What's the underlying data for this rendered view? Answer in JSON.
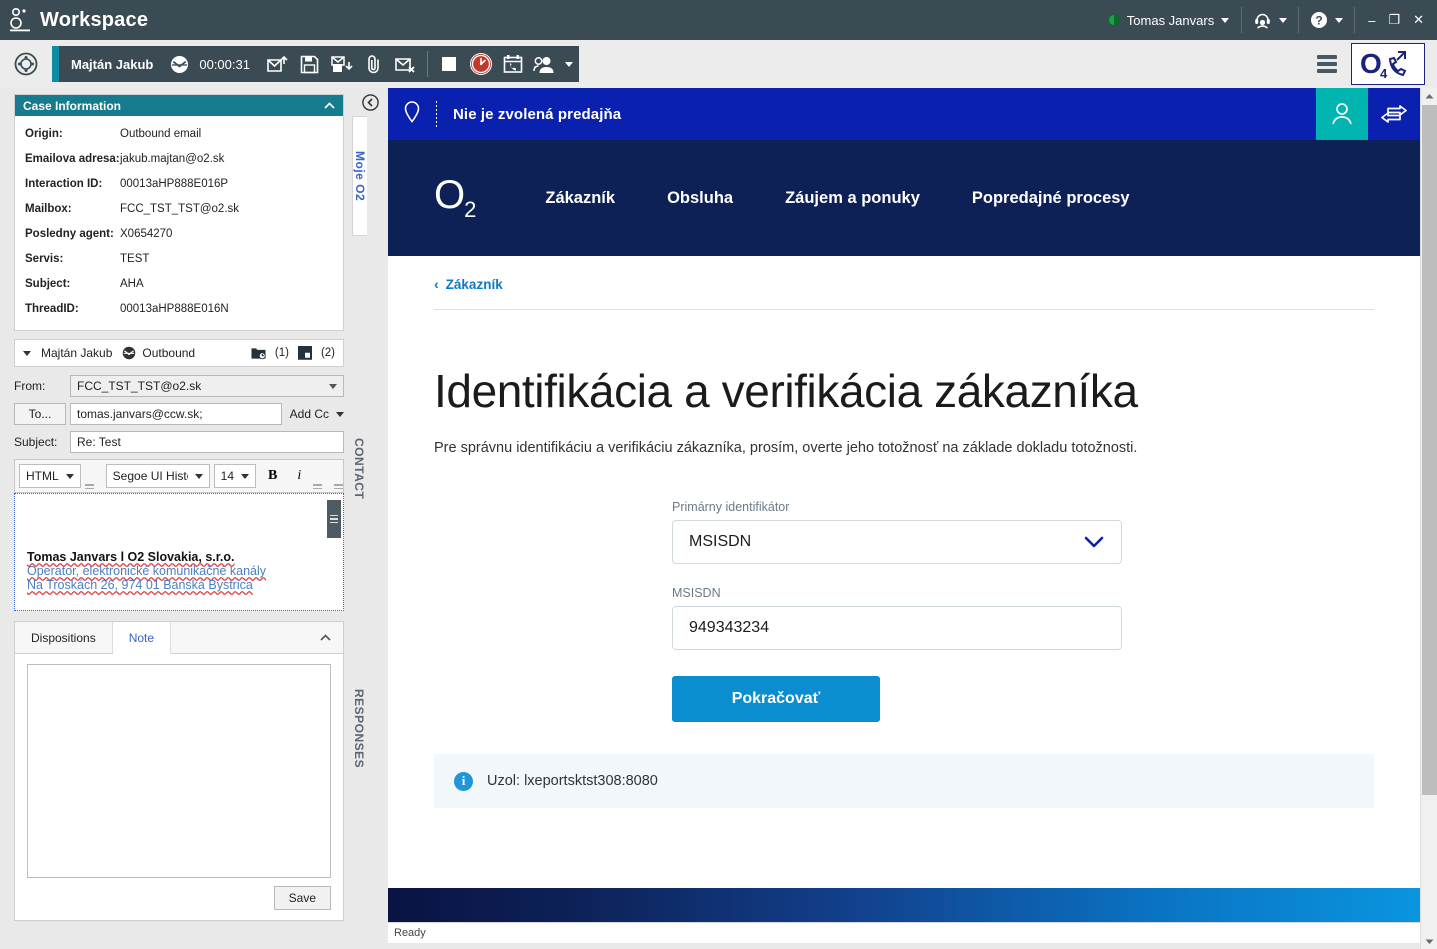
{
  "titlebar": {
    "app_name": "Workspace",
    "logo_icon": "genesys-logo-icon",
    "user_name": "Tomas Janvars",
    "status_icon": "status-half-available-icon",
    "agent_icon": "agent-headset-icon",
    "help_icon": "help-question-icon",
    "minimize": "–",
    "maximize": "❐",
    "close": "✕"
  },
  "toolbar": {
    "target_icon": "target-crosshair-icon",
    "interaction_name": "Majtán Jakub",
    "interaction_channel_icon": "email-channel-icon",
    "timer": "00:00:31",
    "icons": [
      "send-email-icon",
      "save-draft-icon",
      "move-to-folder-icon",
      "attach-file-icon",
      "delete-email-icon"
    ],
    "icons2": [
      "stop-white-square-icon",
      "red-clock-icon",
      "schedule-callback-icon",
      "consult-person-icon"
    ],
    "menu_icon": "hamburger-menu-icon",
    "o2_call_badge": "O",
    "o2_call_sub": "4",
    "o2_call_icon": "phone-outbound-icon"
  },
  "case_information": {
    "title": "Case Information",
    "collapse_icon": "chevron-up-icon",
    "rows": [
      {
        "label": "Origin:",
        "value": "Outbound email"
      },
      {
        "label": "Emailova adresa:",
        "value": "jakub.majtan@o2.sk"
      },
      {
        "label": "Interaction ID:",
        "value": "00013aHP888E016P"
      },
      {
        "label": "Mailbox:",
        "value": "FCC_TST_TST@o2.sk"
      },
      {
        "label": "Posledny agent:",
        "value": "X0654270"
      },
      {
        "label": "Servis:",
        "value": "TEST"
      },
      {
        "label": "Subject:",
        "value": "AHA"
      },
      {
        "label": "ThreadID:",
        "value": "00013aHP888E016N"
      }
    ]
  },
  "interaction_row": {
    "name": "Majtán Jakub",
    "channel_icon": "email-channel-icon",
    "direction": "Outbound",
    "attachments_icon": "folder-clock-icon",
    "attachments_count": "(1)",
    "history_icon": "history-clock-icon",
    "history_count": "(2)"
  },
  "email_form": {
    "from_label": "From:",
    "from_value": "FCC_TST_TST@o2.sk",
    "to_label": "To...",
    "to_value": "tomas.janvars@ccw.sk;",
    "add_cc_label": "Add Cc",
    "subject_label": "Subject:",
    "subject_value": "Re: Test",
    "editor": {
      "format": "HTML",
      "font": "Segoe UI Histo",
      "size": "14",
      "bold": "B",
      "italic": "i"
    },
    "signature": {
      "line1": "Tomas Janvars l O2 Slovakia, s.r.o.",
      "line2": "Operator, elektronické komunikačné kanály",
      "line3": "Na Troskách 26, 974 01 Banská Bystrica"
    }
  },
  "bottom_tabs": {
    "tabs": [
      {
        "label": "Dispositions",
        "active": false
      },
      {
        "label": "Note",
        "active": true
      }
    ],
    "collapse_icon": "chevron-up-icon",
    "note_value": "",
    "save_label": "Save"
  },
  "rail": {
    "collapse_icon": "collapse-left-icon",
    "tabs": [
      {
        "label": "Moje O2",
        "active": true
      },
      {
        "label": "CONTACT",
        "active": false
      },
      {
        "label": "RESPONSES",
        "active": false
      }
    ]
  },
  "browser": {
    "topbar": {
      "pin_icon": "location-pin-icon",
      "shop_text": "Nie je zvolená predajňa",
      "person_icon": "person-icon",
      "swap_icon": "swap-arrows-icon"
    },
    "nav": {
      "logo": "O",
      "logo_sub": "2",
      "links": [
        "Zákazník",
        "Obsluha",
        "Záujem a ponuky",
        "Popredajné procesy"
      ]
    },
    "breadcrumb": {
      "back_icon": "chevron-left-icon",
      "label": "Zákazník"
    },
    "page": {
      "heading": "Identifikácia a verifikácia zákazníka",
      "subtitle": "Pre správnu identifikáciu a verifikáciu zákazníka, prosím, overte jeho totožnosť na základe dokladu totožnosti.",
      "primary_id_label": "Primárny identifikátor",
      "primary_id_value": "MSISDN",
      "primary_id_chevron": "chevron-down-icon",
      "msisdn_label": "MSISDN",
      "msisdn_value": "949343234",
      "submit_label": "Pokračovať",
      "info_icon": "info-circle-icon",
      "info_text": "Uzol: lxeportsktst308:8080"
    }
  },
  "scrollbar": {
    "up_icon": "scroll-up-icon",
    "down_icon": "scroll-down-icon"
  },
  "statusbar": {
    "text": "Ready"
  },
  "colors": {
    "titlebar_bg": "#3b4b54",
    "case_header_teal": "#167b8d",
    "o2_blue": "#0a21b0",
    "o2_navy": "#0d2157",
    "o2_teal": "#00b5b0",
    "button_blue": "#0a8ed0",
    "link_blue": "#0a7bc4",
    "interaction_accent": "#0e8ca0"
  }
}
